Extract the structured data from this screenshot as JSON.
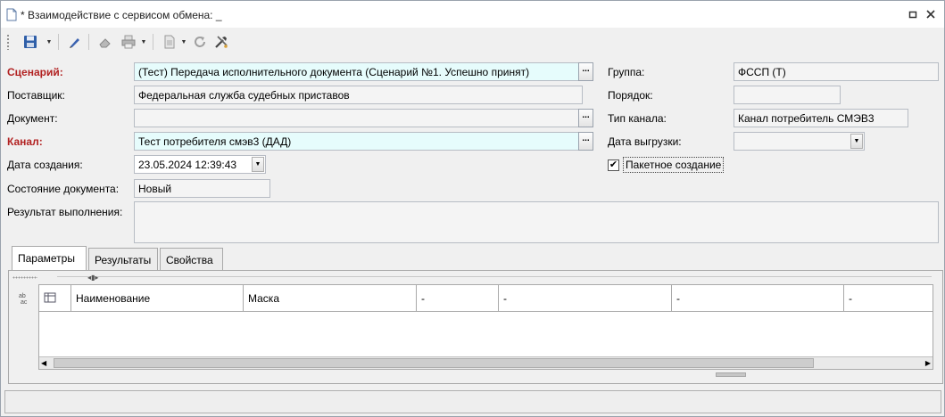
{
  "window": {
    "title": "* Взаимодействие с сервисом обмена: _"
  },
  "toolbar": {
    "items": [
      "save-icon",
      "save-dropdown",
      "pen-icon",
      "eraser-icon",
      "print-icon",
      "document-icon",
      "refresh-icon",
      "tools-icon"
    ]
  },
  "form": {
    "scenario": {
      "label": "Сценарий:",
      "value": "(Тест) Передача исполнительного документа (Сценарий №1. Успешно принят)",
      "button": "..."
    },
    "supplier": {
      "label": "Поставщик:",
      "value": "Федеральная служба судебных приставов"
    },
    "document": {
      "label": "Документ:",
      "value": "",
      "button": "..."
    },
    "channel": {
      "label": "Канал:",
      "value": "Тест потребителя смэв3 (ДАД)",
      "button": "..."
    },
    "created": {
      "label": "Дата создания:",
      "value": "23.05.2024 12:39:43"
    },
    "state": {
      "label": "Состояние документа:",
      "value": "Новый"
    },
    "result": {
      "label": "Результат выполнения:",
      "value": ""
    },
    "group": {
      "label": "Группа:",
      "value": "ФССП (Т)"
    },
    "order": {
      "label": "Порядок:",
      "value": ""
    },
    "channel_type": {
      "label": "Тип канала:",
      "value": "Канал потребитель СМЭВ3"
    },
    "upload_date": {
      "label": "Дата выгрузки:",
      "value": ""
    },
    "batch": {
      "label": "Пакетное создание",
      "checked": true
    }
  },
  "tabs": [
    {
      "label": "Параметры",
      "active": true
    },
    {
      "label": "Результаты",
      "active": false
    },
    {
      "label": "Свойства",
      "active": false
    }
  ],
  "grid": {
    "columns": [
      "Наименование",
      "Маска",
      "-",
      "-",
      "-",
      "-"
    ],
    "rows": []
  },
  "colors": {
    "required_label": "#b22222",
    "required_field_bg": "#e6fcfc",
    "window_bg": "#f0f0f0"
  }
}
